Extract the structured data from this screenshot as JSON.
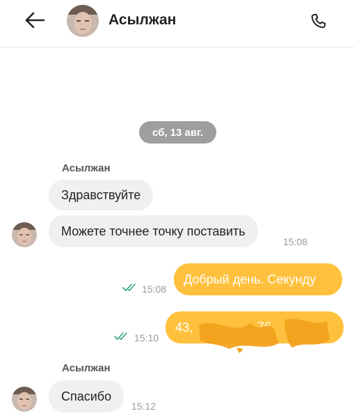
{
  "header": {
    "contact_name": "Асылжан",
    "back_icon": "arrow-left-icon",
    "call_icon": "phone-icon"
  },
  "chat": {
    "date_chip": "сб, 13 авг.",
    "messages": [
      {
        "direction": "in",
        "sender": "Асылжан",
        "text": "Здравствуйте",
        "time": ""
      },
      {
        "direction": "in",
        "sender": "",
        "text": "Можете точнее точку поставить",
        "time": "15:08"
      },
      {
        "direction": "out",
        "text": "Добрый день. Секунду",
        "time": "15:08",
        "status": "read"
      },
      {
        "direction": "out",
        "text_visible_start": "43,",
        "text_visible_mid": "76",
        "redacted": true,
        "time": "15:10",
        "status": "read"
      },
      {
        "direction": "in",
        "sender": "Асылжан",
        "text": "Спасибо",
        "time": "15:12"
      }
    ]
  },
  "colors": {
    "outgoing_bubble": "#ffc13d",
    "incoming_bubble": "#f0f0f0",
    "date_chip": "#9e9e9e",
    "read_check": "#2aa37a"
  }
}
